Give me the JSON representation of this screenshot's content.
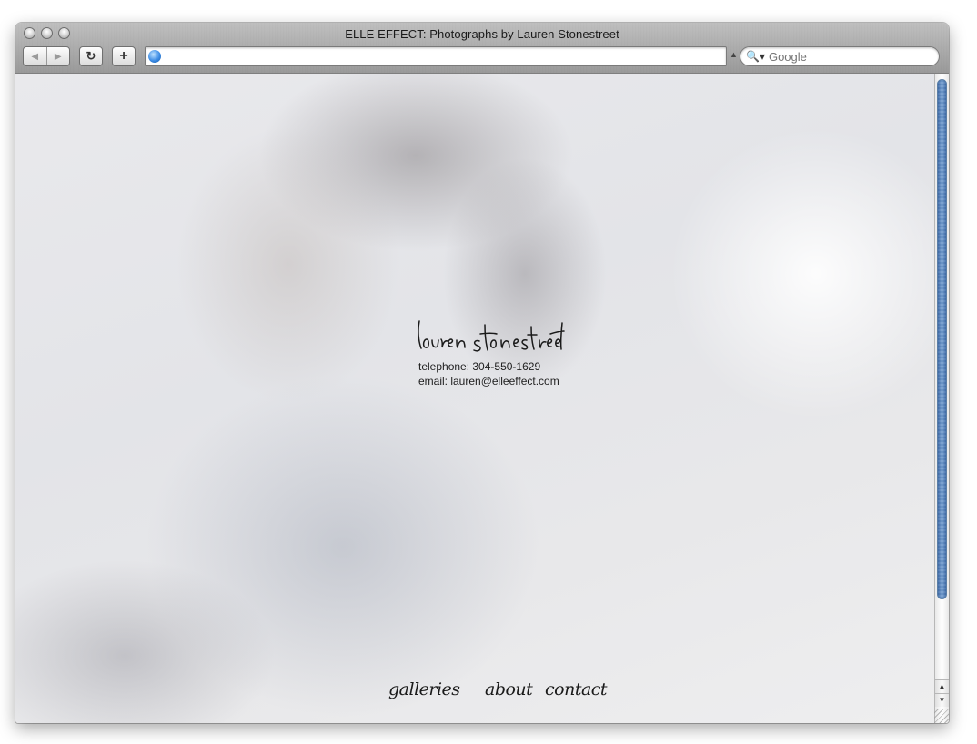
{
  "window": {
    "title": "ELLE EFFECT: Photographs by Lauren Stonestreet"
  },
  "toolbar": {
    "back_icon": "back-arrow-icon",
    "forward_icon": "forward-arrow-icon",
    "reload_glyph": "↻",
    "add_bookmark_glyph": "+",
    "url_value": "",
    "search_placeholder": "Google"
  },
  "page": {
    "logo_text": "lauren stonestreet",
    "telephone": "telephone: 304-550-1629",
    "email": "email: lauren@elleeffect.com",
    "nav": {
      "galleries": "galleries",
      "about": "about",
      "contact": "contact"
    }
  },
  "colors": {
    "accent_scroll": "#8fb3d9",
    "text": "#1e1e1e"
  }
}
